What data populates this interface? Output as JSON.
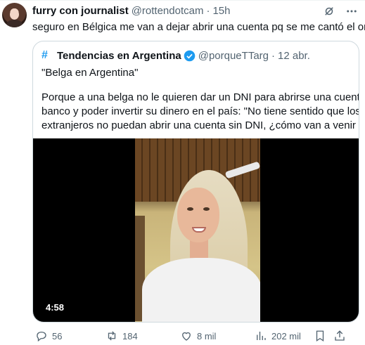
{
  "tweet": {
    "author_name": "furry con journalist",
    "author_handle": "@rottendotcam",
    "separator": "·",
    "time": "15h",
    "text": "seguro en Bélgica me van a dejar abrir una cuenta pq se me cantó el orto"
  },
  "quote": {
    "hash_icon": "#",
    "author_name": "Tendencias en Argentina",
    "author_handle": "@porqueTTarg",
    "separator": "·",
    "time": "12 abr.",
    "title": "\"Belga en Argentina\"",
    "body_lines": [
      "Porque a una belga no le quieren dar un DNI para abrirse una cuenta de",
      "banco y poder invertir su dinero en el país: \"No tiene sentido que los",
      "extranjeros no puedan abrir una cuenta sin DNI, ¿cómo van a venir a ..."
    ],
    "video_duration": "4:58"
  },
  "actions": {
    "replies": "56",
    "reposts": "184",
    "likes": "8 mil",
    "views": "202 mil"
  },
  "colors": {
    "accent": "#1d9bf0",
    "muted": "#536471",
    "border": "#cfd9de",
    "repost_green": "#00ba7c"
  },
  "icons": [
    "grok-icon",
    "more-icon",
    "verified-icon",
    "reply-icon",
    "repost-icon",
    "like-icon",
    "views-icon",
    "bookmark-icon",
    "share-icon"
  ]
}
